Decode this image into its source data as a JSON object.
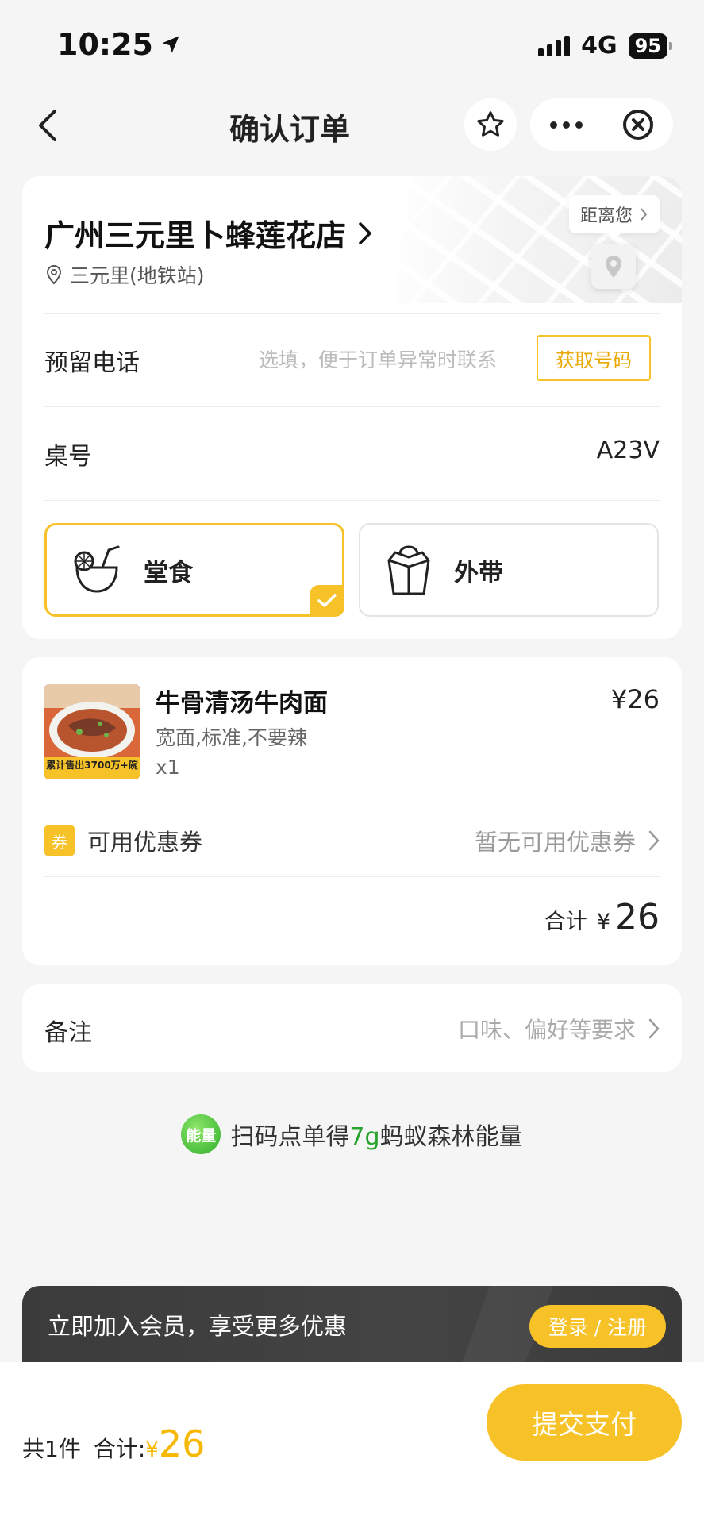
{
  "status_bar": {
    "time": "10:25",
    "network": "4G",
    "battery": "95"
  },
  "nav": {
    "title": "确认订单"
  },
  "store": {
    "name": "广州三元里卜蜂莲花店",
    "location": "三元里(地铁站)",
    "distance_label": "距离您"
  },
  "phone": {
    "label": "预留电话",
    "placeholder": "选填，便于订单异常时联系",
    "button": "获取号码"
  },
  "table": {
    "label": "桌号",
    "value": "A23V"
  },
  "dining_modes": [
    {
      "label": "堂食",
      "selected": true
    },
    {
      "label": "外带",
      "selected": false
    }
  ],
  "item": {
    "name": "牛骨清汤牛肉面",
    "spec": "宽面,标准,不要辣",
    "qty": "x1",
    "price": "¥26",
    "image_text": "累计售出3700万+碗"
  },
  "coupon": {
    "badge": "券",
    "label": "可用优惠券",
    "value": "暂无可用优惠券"
  },
  "subtotal": {
    "label": "合计",
    "currency": "¥",
    "amount": "26"
  },
  "remark": {
    "label": "备注",
    "placeholder": "口味、偏好等要求"
  },
  "energy": {
    "badge": "能量",
    "prefix": "扫码点单得",
    "accent": "7g",
    "suffix": "蚂蚁森林能量"
  },
  "member": {
    "text": "立即加入会员，享受更多优惠",
    "button": "登录 / 注册"
  },
  "footer": {
    "count": "共1件",
    "sum_label": "合计:",
    "currency": "¥",
    "amount": "26",
    "pay_button": "提交支付"
  },
  "colors": {
    "accent": "#f6c228",
    "energy_green": "#29a32e",
    "member_bg": "#3f3f3f"
  }
}
